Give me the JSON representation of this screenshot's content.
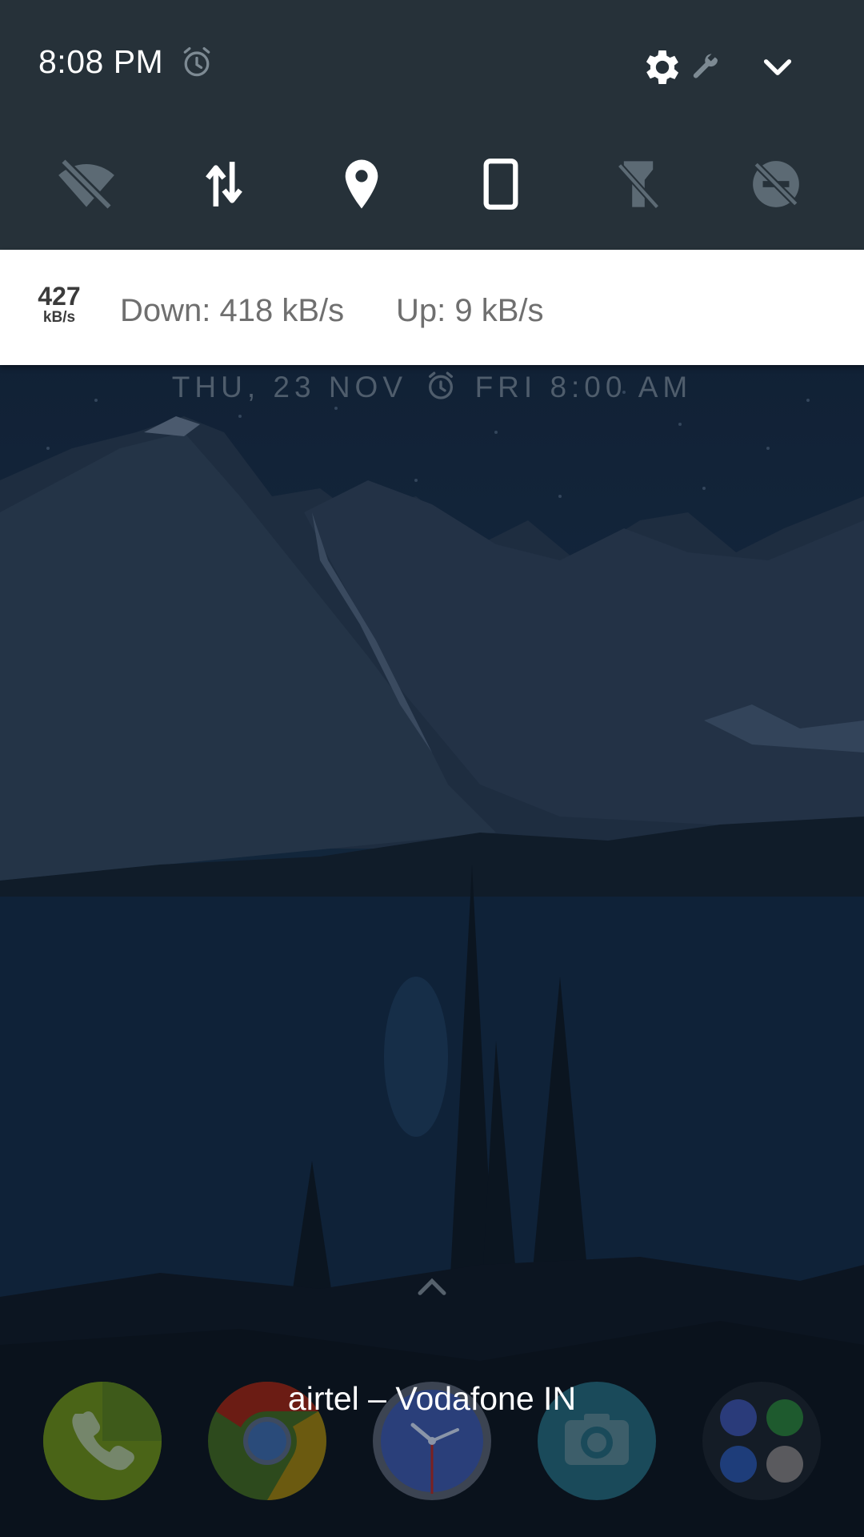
{
  "status": {
    "time": "8:08 PM",
    "icons": [
      "alarm-icon",
      "settings-gear-icon",
      "wrench-icon",
      "expand-chevron-icon"
    ]
  },
  "quick_tiles": [
    {
      "name": "wifi-off-icon",
      "state": "off"
    },
    {
      "name": "mobile-data-icon",
      "state": "on"
    },
    {
      "name": "location-icon",
      "state": "on"
    },
    {
      "name": "rotation-portrait-icon",
      "state": "on"
    },
    {
      "name": "flashlight-off-icon",
      "state": "off"
    },
    {
      "name": "do-not-disturb-off-icon",
      "state": "off"
    }
  ],
  "notification": {
    "badge_value": "427",
    "badge_unit": "kB/s",
    "down": "Down: 418 kB/s",
    "up": "Up: 9 kB/s"
  },
  "lockscreen": {
    "date": "THU, 23 NOV",
    "alarm": "FRI 8:00 AM",
    "carrier": "airtel – Vodafone IN"
  },
  "dock": {
    "apps": [
      "phone-app-icon",
      "chrome-app-icon",
      "clock-app-icon",
      "camera-app-icon"
    ],
    "folder_apps": [
      "messages-app-icon",
      "whatsapp-app-icon",
      "messenger-app-icon",
      "gmail-app-icon"
    ]
  },
  "colors": {
    "panel_bg": "#263139",
    "notification_bg": "#ffffff",
    "text_secondary": "#6f6f6f"
  }
}
